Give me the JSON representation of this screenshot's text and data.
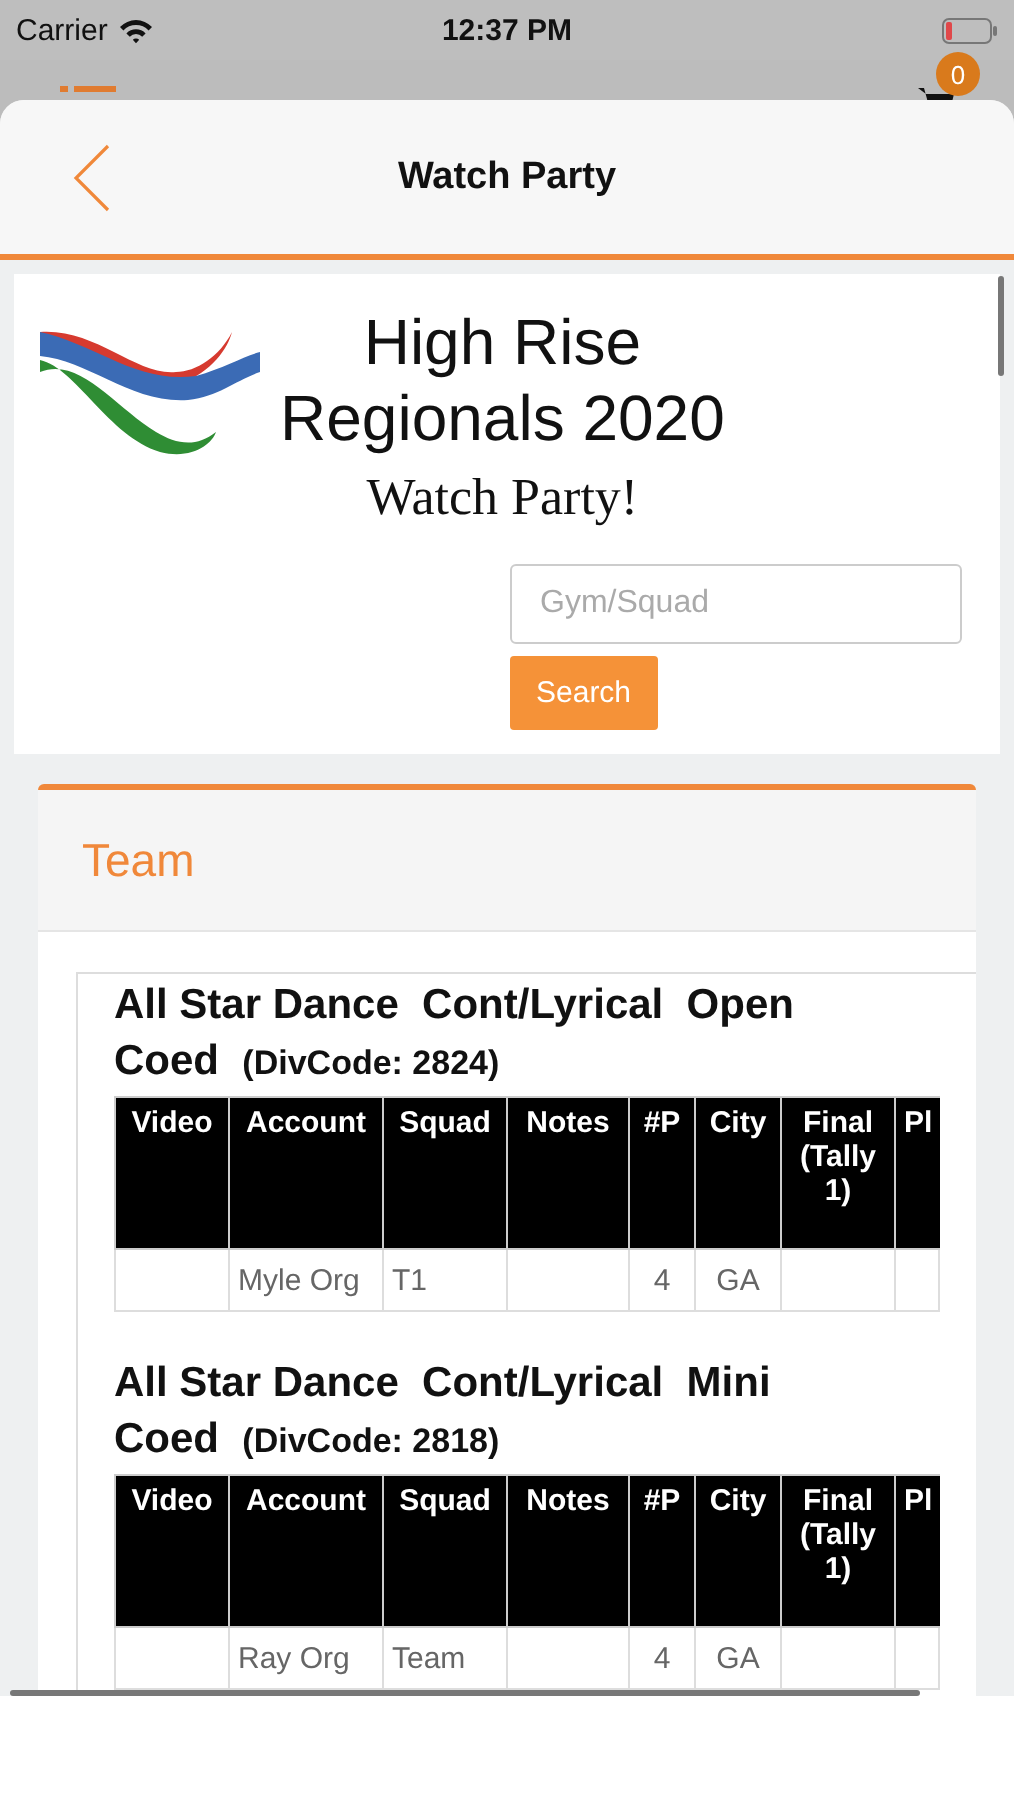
{
  "status_bar": {
    "carrier": "Carrier",
    "time": "12:37 PM"
  },
  "background_app": {
    "cart_badge": "0"
  },
  "nav": {
    "title": "Watch Party"
  },
  "banner": {
    "title_line1": "High Rise",
    "title_line2": "Regionals 2020",
    "subtitle": "Watch Party!"
  },
  "search": {
    "placeholder": "Gym/Squad",
    "button": "Search"
  },
  "section": {
    "title": "Team"
  },
  "divisions": [
    {
      "name": "All Star Dance  Cont/Lyrical  Open Coed",
      "code": "(DivCode: 2824)",
      "columns": [
        "Video",
        "Account",
        "Squad",
        "Notes",
        "#P",
        "City",
        "Final (Tally 1)",
        "Pl"
      ],
      "rows": [
        [
          "",
          "Myle Org",
          "T1",
          "",
          "4",
          "GA",
          "",
          ""
        ]
      ]
    },
    {
      "name": "All Star Dance  Cont/Lyrical  Mini Coed",
      "code": "(DivCode: 2818)",
      "columns": [
        "Video",
        "Account",
        "Squad",
        "Notes",
        "#P",
        "City",
        "Final (Tally 1)",
        "Pl"
      ],
      "rows": [
        [
          "",
          "Ray Org",
          "Team",
          "",
          "4",
          "GA",
          "",
          ""
        ]
      ]
    }
  ]
}
